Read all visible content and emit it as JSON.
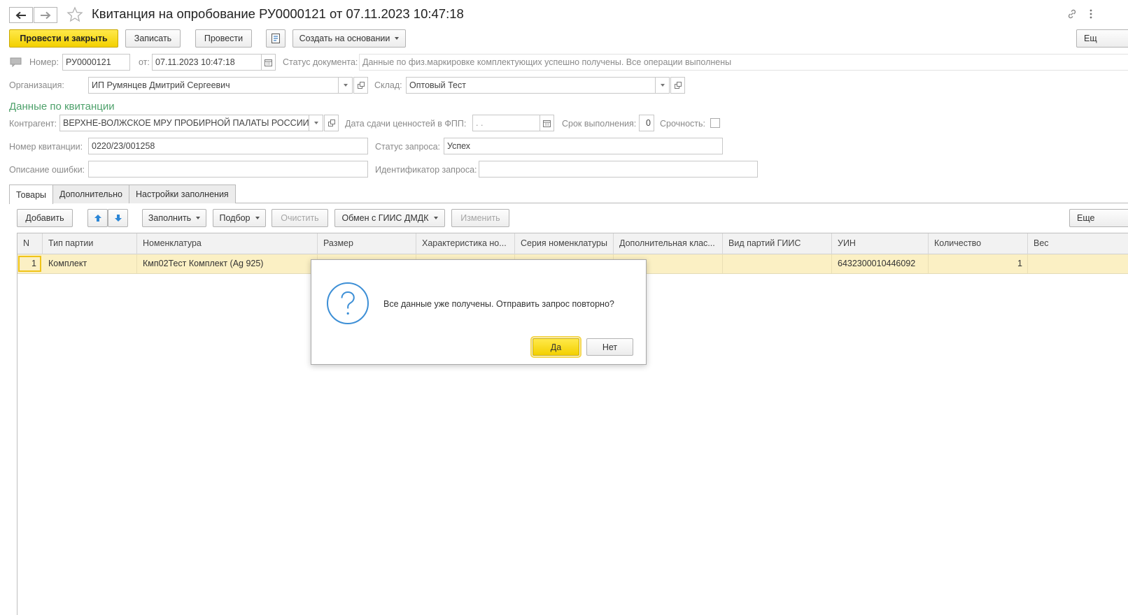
{
  "header": {
    "title": "Квитанция на опробование РУ0000121 от 07.11.2023 10:47:18"
  },
  "toolbar": {
    "post_close": "Провести и закрыть",
    "save": "Записать",
    "post": "Провести",
    "create_based": "Создать на основании",
    "more": "Ещ"
  },
  "form": {
    "number_label": "Номер:",
    "number_value": "РУ0000121",
    "date_label": "от:",
    "date_value": "07.11.2023 10:47:18",
    "status_label": "Статус документа:",
    "status_value": "Данные по физ.маркировке комплектующих успешно получены. Все операции выполнены",
    "org_label": "Организация:",
    "org_value": "ИП Румянцев Дмитрий Сергеевич",
    "warehouse_label": "Склад:",
    "warehouse_value": "Оптовый Тест",
    "section_title": "Данные по квитанции",
    "contractor_label": "Контрагент:",
    "contractor_value": "ВЕРХНЕ-ВОЛЖСКОЕ МРУ ПРОБИРНОЙ ПАЛАТЫ РОССИИ",
    "delivery_date_label": "Дата сдачи ценностей в ФПП:",
    "delivery_date_value": " .  .",
    "term_label": "Срок выполнения:",
    "term_value": "0",
    "urgency_label": "Срочность:",
    "receipt_number_label": "Номер квитанции:",
    "receipt_number_value": "0220/23/001258",
    "request_status_label": "Статус запроса:",
    "request_status_value": "Успех",
    "error_desc_label": "Описание ошибки:",
    "error_desc_value": "",
    "request_id_label": "Идентификатор запроса:",
    "request_id_value": ""
  },
  "tabs": [
    {
      "label": "Товары"
    },
    {
      "label": "Дополнительно"
    },
    {
      "label": "Настройки заполнения"
    }
  ],
  "table_toolbar": {
    "add": "Добавить",
    "fill": "Заполнить",
    "pick": "Подбор",
    "clear": "Очистить",
    "exchange": "Обмен с ГИИС ДМДК",
    "edit": "Изменить",
    "more": "Еще"
  },
  "table": {
    "columns": [
      "N",
      "Тип партии",
      "Номенклатура",
      "Размер",
      "Характеристика но...",
      "Серия номенклатуры",
      "Дополнительная клас...",
      "Вид партий ГИИС",
      "УИН",
      "Количество",
      "Вес"
    ],
    "rows": [
      {
        "n": "1",
        "batch_type": "Комплект",
        "nomenclature": "Кмп02Тест Комплект (Ag 925)",
        "size": "",
        "characteristic": "",
        "series": "",
        "extra_class": "",
        "giis_type": "",
        "uin": "6432300010446092",
        "quantity": "1",
        "weight": ""
      }
    ]
  },
  "dialog": {
    "message": "Все данные уже получены. Отправить запрос повторно?",
    "yes": "Да",
    "no": "Нет"
  },
  "colors": {
    "accent_yellow": "#f3d000",
    "section_green": "#4ea16b",
    "selected_row": "#fbf0c4",
    "question_icon": "#3d8fd6"
  }
}
